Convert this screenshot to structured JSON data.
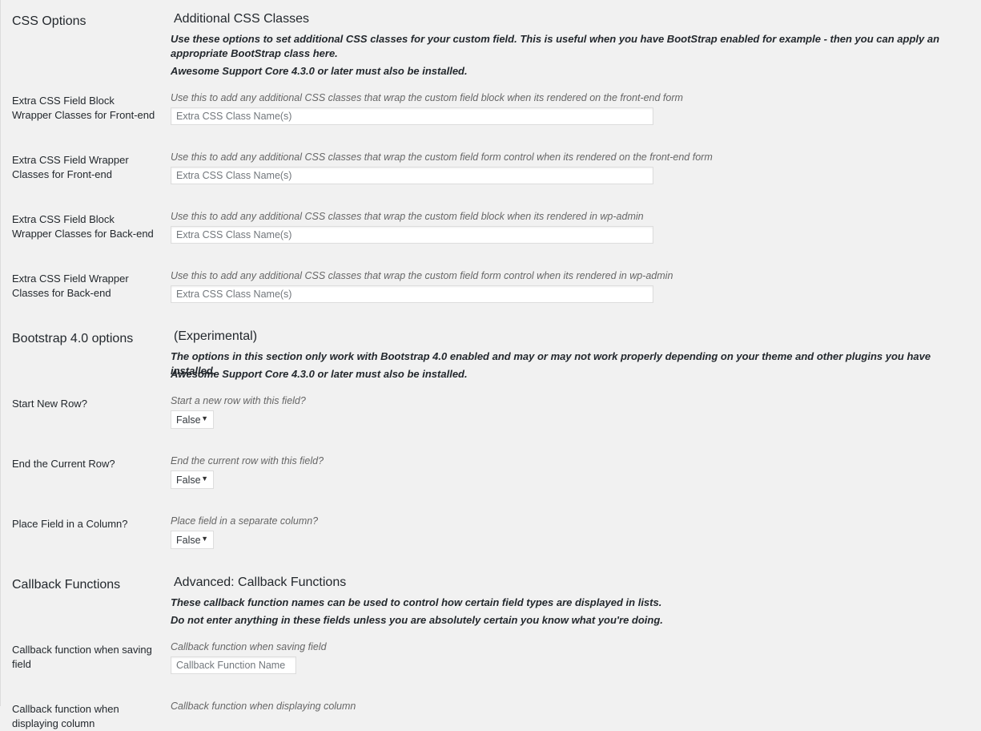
{
  "css_options": {
    "title": "CSS Options",
    "heading": "Additional CSS Classes",
    "note_1": "Use these options to set additional CSS classes for your custom field. This is useful when you have BootStrap enabled for example - then you can apply an appropriate BootStrap class here.",
    "note_2": "Awesome Support Core 4.3.0 or later must also be installed.",
    "fields": [
      {
        "label": "Extra CSS Field Block Wrapper Classes for Front-end",
        "description": "Use this to add any additional CSS classes that wrap the custom field block when its rendered on the front-end form",
        "placeholder": "Extra CSS Class Name(s)",
        "value": ""
      },
      {
        "label": "Extra CSS Field Wrapper Classes for Front-end",
        "description": "Use this to add any additional CSS classes that wrap the custom field form control when its rendered on the front-end form",
        "placeholder": "Extra CSS Class Name(s)",
        "value": ""
      },
      {
        "label": "Extra CSS Field Block Wrapper Classes for Back-end",
        "description": "Use this to add any additional CSS classes that wrap the custom field block when its rendered in wp-admin",
        "placeholder": "Extra CSS Class Name(s)",
        "value": ""
      },
      {
        "label": "Extra CSS Field Wrapper Classes for Back-end",
        "description": "Use this to add any additional CSS classes that wrap the custom field form control when its rendered in wp-admin",
        "placeholder": "Extra CSS Class Name(s)",
        "value": ""
      }
    ]
  },
  "bootstrap_options": {
    "title": "Bootstrap 4.0 options",
    "heading": "(Experimental)",
    "note_1": "The options in this section only work with Bootstrap 4.0 enabled and may or may not work properly depending on your theme and other plugins you have installed.",
    "note_2": "Awesome Support Core 4.3.0 or later must also be installed.",
    "fields": [
      {
        "label": "Start New Row?",
        "description": "Start a new row with this field?",
        "selected": "False"
      },
      {
        "label": "End the Current Row?",
        "description": "End the current row with this field?",
        "selected": "False"
      },
      {
        "label": "Place Field in a Column?",
        "description": "Place field in a separate column?",
        "selected": "False"
      }
    ]
  },
  "callback_functions": {
    "title": "Callback Functions",
    "heading": "Advanced: Callback Functions",
    "note_1": "These callback function names can be used to control how certain field types are displayed in lists.",
    "note_2": "Do not enter anything in these fields unless you are absolutely certain you know what you're doing.",
    "fields": [
      {
        "label": "Callback function when saving field",
        "description": "Callback function when saving field",
        "placeholder": "Callback Function Name",
        "value": ""
      },
      {
        "label": "Callback function when displaying column",
        "description": "Callback function when displaying column"
      }
    ]
  },
  "icons": {
    "dropdown_arrow": "▼"
  }
}
